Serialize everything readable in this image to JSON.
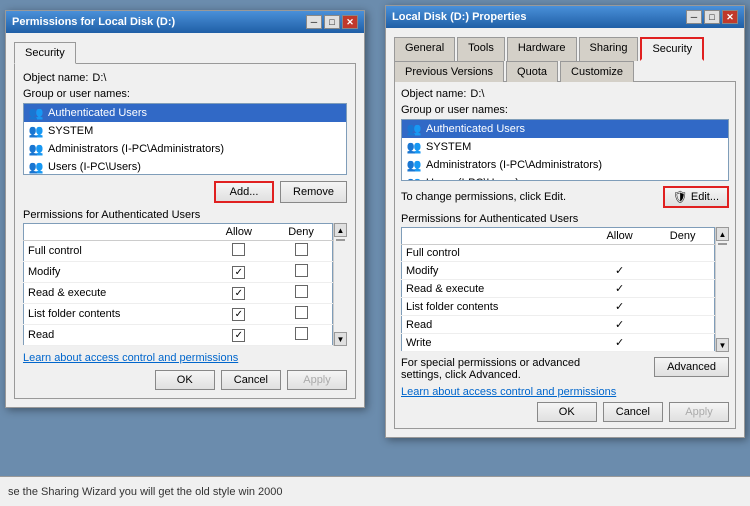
{
  "left_dialog": {
    "title": "Permissions for Local Disk (D:)",
    "close_btn": "✕",
    "tab_security": "Security",
    "object_label": "Object name:",
    "object_value": "D:\\",
    "group_label": "Group or user names:",
    "users": [
      {
        "icon": "👥",
        "name": "Authenticated Users"
      },
      {
        "icon": "👥",
        "name": "SYSTEM"
      },
      {
        "icon": "👥",
        "name": "Administrators (I-PC\\Administrators)"
      },
      {
        "icon": "👥",
        "name": "Users (I-PC\\Users)"
      }
    ],
    "add_btn": "Add...",
    "remove_btn": "Remove",
    "permissions_label": "Permissions for Authenticated Users",
    "allow_col": "Allow",
    "deny_col": "Deny",
    "permissions": [
      {
        "name": "Full control",
        "allow": false,
        "deny": false
      },
      {
        "name": "Modify",
        "allow": true,
        "deny": false
      },
      {
        "name": "Read & execute",
        "allow": true,
        "deny": false
      },
      {
        "name": "List folder contents",
        "allow": true,
        "deny": false
      },
      {
        "name": "Read",
        "allow": true,
        "deny": false
      }
    ],
    "link_text": "Learn about access control and permissions",
    "ok_btn": "OK",
    "cancel_btn": "Cancel",
    "apply_btn": "Apply"
  },
  "right_dialog": {
    "title": "Local Disk (D:) Properties",
    "close_btn": "✕",
    "tabs": [
      {
        "label": "General",
        "active": false
      },
      {
        "label": "Tools",
        "active": false
      },
      {
        "label": "Hardware",
        "active": false
      },
      {
        "label": "Sharing",
        "active": false
      },
      {
        "label": "Security",
        "active": true,
        "highlighted": true
      },
      {
        "label": "Previous Versions",
        "active": false
      },
      {
        "label": "Quota",
        "active": false
      },
      {
        "label": "Customize",
        "active": false
      }
    ],
    "object_label": "Object name:",
    "object_value": "D:\\",
    "group_label": "Group or user names:",
    "users": [
      {
        "icon": "👥",
        "name": "Authenticated Users"
      },
      {
        "icon": "👥",
        "name": "SYSTEM"
      },
      {
        "icon": "👥",
        "name": "Administrators (I-PC\\Administrators)"
      },
      {
        "icon": "👥",
        "name": "Users (I-PC\\Users)"
      }
    ],
    "edit_instruction": "To change permissions, click Edit.",
    "edit_btn": "Edit...",
    "permissions_label": "Permissions for Authenticated Users",
    "allow_col": "Allow",
    "deny_col": "Deny",
    "permissions": [
      {
        "name": "Full control",
        "allow": false,
        "deny": false
      },
      {
        "name": "Modify",
        "allow": true,
        "deny": false
      },
      {
        "name": "Read & execute",
        "allow": true,
        "deny": false
      },
      {
        "name": "List folder contents",
        "allow": true,
        "deny": false
      },
      {
        "name": "Read",
        "allow": true,
        "deny": false
      },
      {
        "name": "Write",
        "allow": true,
        "deny": false
      }
    ],
    "special_text": "For special permissions or advanced settings, click Advanced.",
    "advanced_btn": "Advanced",
    "link_text": "Learn about access control and permissions",
    "ok_btn": "OK",
    "cancel_btn": "Cancel",
    "apply_btn": "Apply"
  },
  "bottom_bar": {
    "text": "se the Sharing Wizard you will get the old style win 2000"
  },
  "colors": {
    "titlebar_start": "#4a90d9",
    "titlebar_end": "#1f5fa6",
    "highlight_red": "#e02020",
    "dialog_bg": "#f0f0f0",
    "listbox_bg": "#ffffff",
    "active_tab": "#f0f0f0",
    "inactive_tab": "#d4d0c8"
  }
}
